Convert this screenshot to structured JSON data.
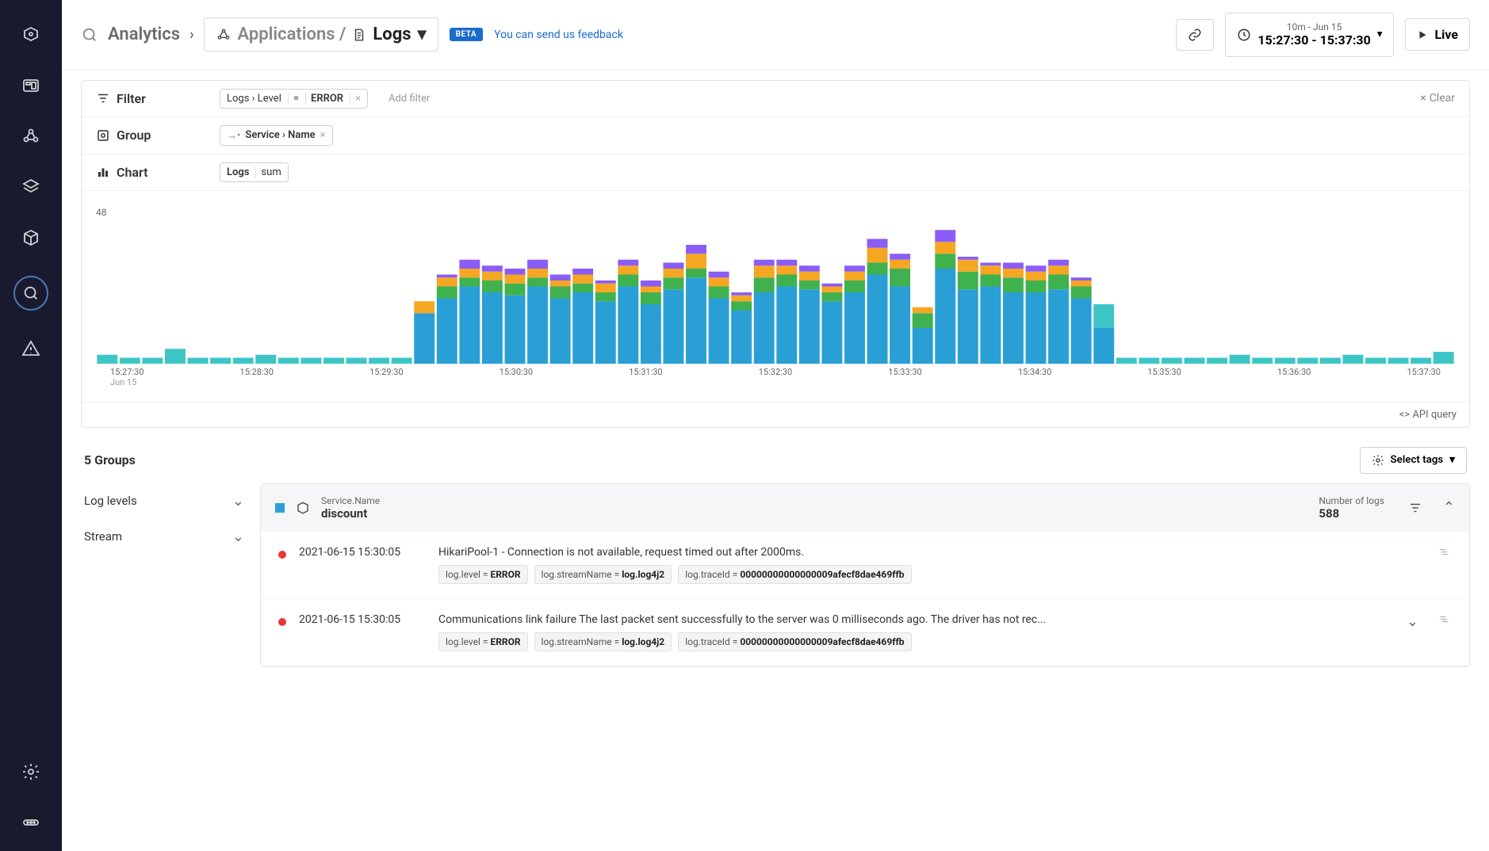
{
  "sidebar": {
    "icons": [
      "home",
      "dashboard",
      "apps",
      "layers",
      "cube",
      "search",
      "alert",
      "settings",
      "more"
    ],
    "active_index": 5
  },
  "topbar": {
    "analytics_label": "Analytics",
    "breadcrumb_apps": "Applications /",
    "breadcrumb_logs": "Logs",
    "beta_label": "BETA",
    "feedback_text": "You can send us feedback",
    "timerange_top": "10m - Jun 15",
    "timerange_bottom": "15:27:30 - 15:37:30",
    "live_label": "Live"
  },
  "filter": {
    "label": "Filter",
    "chip_path": "Logs › Level",
    "chip_op": "=",
    "chip_val": "ERROR",
    "add_placeholder": "Add filter",
    "clear_label": "Clear"
  },
  "group": {
    "label": "Group",
    "chip_path": "Service › Name"
  },
  "chart": {
    "label": "Chart",
    "chip_a": "Logs",
    "chip_b": "sum",
    "api_query": "API query"
  },
  "chart_data": {
    "type": "bar",
    "ylabel": "",
    "ylim": [
      0,
      48
    ],
    "ytick": 48,
    "xlabel_sub": "Jun 15",
    "categories": [
      "15:27:30",
      "15:28:30",
      "15:29:30",
      "15:30:30",
      "15:31:30",
      "15:32:30",
      "15:33:30",
      "15:34:30",
      "15:35:30",
      "15:36:30",
      "15:37:30"
    ],
    "series_colors": {
      "teal": "#3ec5c5",
      "blue": "#2a9fd6",
      "green": "#3fb24f",
      "orange": "#f5a623",
      "purple": "#8b5cf6"
    },
    "bars": [
      {
        "teal": 3
      },
      {
        "teal": 2
      },
      {
        "teal": 2
      },
      {
        "teal": 5
      },
      {
        "teal": 2
      },
      {
        "teal": 2
      },
      {
        "teal": 2
      },
      {
        "teal": 3
      },
      {
        "teal": 2
      },
      {
        "teal": 2
      },
      {
        "teal": 2
      },
      {
        "teal": 2
      },
      {
        "teal": 2
      },
      {
        "teal": 2
      },
      {
        "blue": 17,
        "orange": 4
      },
      {
        "blue": 22,
        "green": 4,
        "orange": 3,
        "purple": 1
      },
      {
        "blue": 26,
        "green": 3,
        "orange": 3,
        "purple": 3
      },
      {
        "blue": 24,
        "green": 4,
        "orange": 3,
        "purple": 2
      },
      {
        "blue": 23,
        "green": 4,
        "orange": 3,
        "purple": 2
      },
      {
        "blue": 26,
        "green": 3,
        "orange": 3,
        "purple": 3
      },
      {
        "blue": 22,
        "green": 4,
        "orange": 2,
        "purple": 2
      },
      {
        "blue": 24,
        "green": 3,
        "orange": 3,
        "purple": 2
      },
      {
        "blue": 21,
        "green": 3,
        "orange": 3,
        "purple": 1
      },
      {
        "blue": 26,
        "green": 4,
        "orange": 3,
        "purple": 2
      },
      {
        "blue": 20,
        "green": 4,
        "orange": 2,
        "purple": 2
      },
      {
        "blue": 25,
        "green": 4,
        "orange": 3,
        "purple": 2
      },
      {
        "blue": 29,
        "green": 3,
        "orange": 5,
        "purple": 3
      },
      {
        "blue": 22,
        "green": 4,
        "orange": 3,
        "purple": 2
      },
      {
        "blue": 18,
        "green": 3,
        "orange": 2,
        "purple": 1
      },
      {
        "blue": 24,
        "green": 5,
        "orange": 4,
        "purple": 2
      },
      {
        "blue": 26,
        "green": 4,
        "orange": 3,
        "purple": 2
      },
      {
        "blue": 25,
        "green": 3,
        "orange": 3,
        "purple": 2
      },
      {
        "blue": 21,
        "green": 3,
        "orange": 2,
        "purple": 1
      },
      {
        "blue": 24,
        "green": 4,
        "orange": 3,
        "purple": 2
      },
      {
        "blue": 30,
        "green": 4,
        "orange": 5,
        "purple": 3
      },
      {
        "blue": 26,
        "green": 6,
        "orange": 3,
        "purple": 2
      },
      {
        "blue": 12,
        "green": 5,
        "orange": 2
      },
      {
        "blue": 32,
        "green": 5,
        "orange": 4,
        "purple": 4
      },
      {
        "blue": 25,
        "green": 6,
        "orange": 4,
        "purple": 1
      },
      {
        "blue": 26,
        "green": 4,
        "orange": 3,
        "purple": 1
      },
      {
        "blue": 24,
        "green": 5,
        "orange": 3,
        "purple": 2
      },
      {
        "blue": 24,
        "green": 4,
        "orange": 3,
        "purple": 2
      },
      {
        "blue": 25,
        "green": 5,
        "orange": 3,
        "purple": 2
      },
      {
        "blue": 22,
        "green": 4,
        "orange": 2,
        "purple": 1
      },
      {
        "blue": 12,
        "teal": 8
      },
      {
        "teal": 2
      },
      {
        "teal": 2
      },
      {
        "teal": 2
      },
      {
        "teal": 2
      },
      {
        "teal": 2
      },
      {
        "teal": 3
      },
      {
        "teal": 2
      },
      {
        "teal": 2
      },
      {
        "teal": 2
      },
      {
        "teal": 2
      },
      {
        "teal": 3
      },
      {
        "teal": 2
      },
      {
        "teal": 2
      },
      {
        "teal": 2
      },
      {
        "teal": 4
      }
    ]
  },
  "groups_section": {
    "title": "5 Groups",
    "select_tags": "Select tags",
    "facets": [
      "Log levels",
      "Stream"
    ]
  },
  "log_header": {
    "service_label": "Service.Name",
    "service_val": "discount",
    "count_label": "Number of logs",
    "count_val": "588"
  },
  "logs": [
    {
      "ts": "2021-06-15 15:30:05",
      "msg": "HikariPool-1 - Connection is not available, request timed out after 2000ms.",
      "tags": [
        {
          "k": "log.level",
          "v": "ERROR"
        },
        {
          "k": "log.streamName",
          "v": "log.log4j2"
        },
        {
          "k": "log.traceId",
          "v": "00000000000000009afecf8dae469ffb"
        }
      ],
      "expandable": false
    },
    {
      "ts": "2021-06-15 15:30:05",
      "msg": "Communications link failure The last packet sent successfully to the server was 0 milliseconds ago. The driver has not rec...",
      "tags": [
        {
          "k": "log.level",
          "v": "ERROR"
        },
        {
          "k": "log.streamName",
          "v": "log.log4j2"
        },
        {
          "k": "log.traceId",
          "v": "00000000000000009afecf8dae469ffb"
        }
      ],
      "expandable": true
    }
  ]
}
